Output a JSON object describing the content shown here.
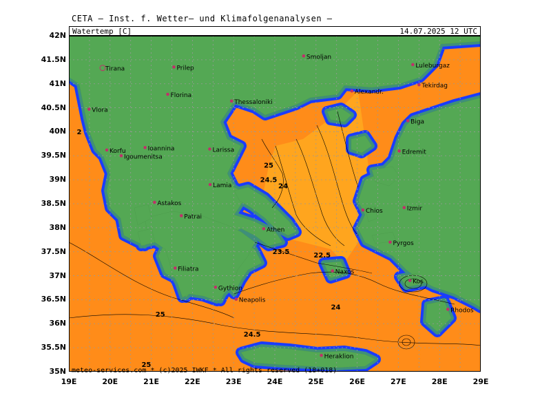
{
  "header": {
    "title": "CETA — Inst. f. Wetter— und Klimafolgenanalysen —"
  },
  "map": {
    "parameter_label": "Watertemp [C]",
    "valid_time": "14.07.2025 12 UTC",
    "credit": "meteo-services.com * (c)2025 IWKF * All rights reserved (18+018)",
    "lat_labels": [
      "42N",
      "41.5N",
      "41N",
      "40.5N",
      "40N",
      "39.5N",
      "39N",
      "38.5N",
      "38N",
      "37.5N",
      "37N",
      "36.5N",
      "36N",
      "35.5N",
      "35N"
    ],
    "lon_labels": [
      "19E",
      "20E",
      "21E",
      "22E",
      "23E",
      "24E",
      "25E",
      "26E",
      "27E",
      "28E",
      "29E"
    ],
    "colors": {
      "land": "#54a854",
      "coast_halo": "#3f8f7a",
      "shallow": "#1a3cff",
      "sea_warm": "#ff8c19",
      "sea_cool": "#ffa51e",
      "city": "#c0306a",
      "grid": "#aaaaaa"
    },
    "cities": [
      {
        "name": "Tirana",
        "lon": 19.82,
        "lat": 41.33
      },
      {
        "name": "Prilep",
        "lon": 21.55,
        "lat": 41.35
      },
      {
        "name": "Smoljan",
        "lon": 24.7,
        "lat": 41.58
      },
      {
        "name": "Luleburgaz",
        "lon": 27.35,
        "lat": 41.4
      },
      {
        "name": "Tekirdag",
        "lon": 27.5,
        "lat": 40.98
      },
      {
        "name": "Florina",
        "lon": 21.4,
        "lat": 40.78
      },
      {
        "name": "Thessaloniki",
        "lon": 22.95,
        "lat": 40.64
      },
      {
        "name": "Alexandr.",
        "lon": 25.87,
        "lat": 40.85
      },
      {
        "name": "Vlora",
        "lon": 19.49,
        "lat": 40.47
      },
      {
        "name": "Biga",
        "lon": 27.23,
        "lat": 40.23
      },
      {
        "name": "Korfu",
        "lon": 19.92,
        "lat": 39.62
      },
      {
        "name": "Ioannina",
        "lon": 20.85,
        "lat": 39.67
      },
      {
        "name": "Larissa",
        "lon": 22.42,
        "lat": 39.64
      },
      {
        "name": "Igoumenitsa",
        "lon": 20.27,
        "lat": 39.5
      },
      {
        "name": "Edremit",
        "lon": 27.02,
        "lat": 39.6
      },
      {
        "name": "Lamia",
        "lon": 22.43,
        "lat": 38.9
      },
      {
        "name": "Astakos",
        "lon": 21.08,
        "lat": 38.53
      },
      {
        "name": "Izmir",
        "lon": 27.14,
        "lat": 38.42
      },
      {
        "name": "Chios",
        "lon": 26.14,
        "lat": 38.37
      },
      {
        "name": "Patrai",
        "lon": 21.73,
        "lat": 38.25
      },
      {
        "name": "Athen",
        "lon": 23.73,
        "lat": 37.98
      },
      {
        "name": "Pyrgos",
        "lon": 26.8,
        "lat": 37.7
      },
      {
        "name": "Filiatra",
        "lon": 21.58,
        "lat": 37.16
      },
      {
        "name": "Gythion",
        "lon": 22.56,
        "lat": 36.76
      },
      {
        "name": "Naxos",
        "lon": 25.4,
        "lat": 37.1
      },
      {
        "name": "Kos",
        "lon": 27.28,
        "lat": 36.9
      },
      {
        "name": "Neapolis",
        "lon": 23.06,
        "lat": 36.51
      },
      {
        "name": "Rhodos",
        "lon": 28.2,
        "lat": 36.3
      },
      {
        "name": "Heraklion",
        "lon": 25.13,
        "lat": 35.34
      }
    ],
    "contour_labels": [
      {
        "text": "25",
        "lon": 23.85,
        "lat": 39.25
      },
      {
        "text": "24.5",
        "lon": 23.85,
        "lat": 38.95
      },
      {
        "text": "24",
        "lon": 24.2,
        "lat": 38.82
      },
      {
        "text": "23.5",
        "lon": 24.15,
        "lat": 37.45
      },
      {
        "text": "22.5",
        "lon": 25.15,
        "lat": 37.38
      },
      {
        "text": "24",
        "lon": 25.48,
        "lat": 36.3
      },
      {
        "text": "25",
        "lon": 21.22,
        "lat": 36.15
      },
      {
        "text": "24.5",
        "lon": 23.45,
        "lat": 35.73
      },
      {
        "text": "25",
        "lon": 20.88,
        "lat": 35.1
      },
      {
        "text": "2",
        "lon": 19.25,
        "lat": 39.95
      }
    ]
  }
}
